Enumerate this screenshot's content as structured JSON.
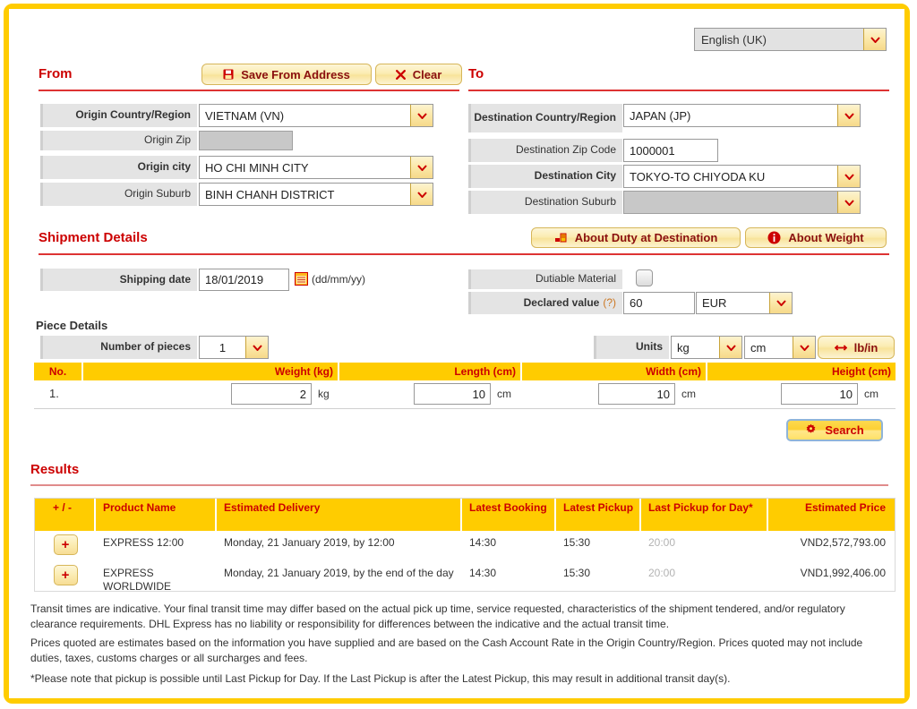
{
  "language": {
    "selected": "English (UK)"
  },
  "from": {
    "heading": "From",
    "save_button": "Save From Address",
    "clear_button": "Clear",
    "fields": [
      {
        "label": "Origin Country/Region",
        "value": "VIETNAM (VN)"
      },
      {
        "label": "Origin Zip",
        "value": ""
      },
      {
        "label": "Origin city",
        "value": "HO CHI MINH CITY"
      },
      {
        "label": "Origin Suburb",
        "value": "BINH CHANH DISTRICT"
      }
    ]
  },
  "to": {
    "heading": "To",
    "fields": [
      {
        "label": "Destination Country/Region",
        "value": "JAPAN (JP)"
      },
      {
        "label": "Destination Zip Code",
        "value": "1000001"
      },
      {
        "label": "Destination City",
        "value": "TOKYO-TO CHIYODA KU"
      },
      {
        "label": "Destination Suburb",
        "value": ""
      }
    ]
  },
  "shipment_details": {
    "heading": "Shipment Details",
    "about_duty_button": "About Duty at Destination",
    "about_weight_button": "About Weight",
    "shipping_date_label": "Shipping date",
    "shipping_date_value": "18/01/2019",
    "shipping_date_format": "(dd/mm/yy)",
    "dutiable_label": "Dutiable Material",
    "declared_value_label": "Declared value",
    "declared_value_help": "(?)",
    "declared_value": "60",
    "currency": "EUR"
  },
  "piece_details": {
    "heading": "Piece Details",
    "number_of_pieces_label": "Number of pieces",
    "number_of_pieces": "1",
    "units_label": "Units",
    "weight_unit": "kg",
    "dim_unit": "cm",
    "toggle_units_button": "lb/in",
    "columns": [
      "No.",
      "Weight (kg)",
      "Length (cm)",
      "Width (cm)",
      "Height (cm)"
    ],
    "rows": [
      {
        "no": "1.",
        "weight": "2",
        "weight_unit": "kg",
        "length": "10",
        "length_unit": "cm",
        "width": "10",
        "width_unit": "cm",
        "height": "10",
        "height_unit": "cm"
      }
    ],
    "search_button": "Search"
  },
  "results": {
    "heading": "Results",
    "columns": [
      "+ / -",
      "Product Name",
      "Estimated Delivery",
      "Latest Booking",
      "Latest Pickup",
      "Last Pickup for Day*",
      "Estimated Price"
    ],
    "rows": [
      {
        "expand": "+",
        "product": "EXPRESS 12:00",
        "delivery": "Monday, 21 January 2019, by 12:00",
        "latest_booking": "14:30",
        "latest_pickup": "15:30",
        "last_pickup_for_day": "20:00",
        "price": "VND2,572,793.00"
      },
      {
        "expand": "+",
        "product": "EXPRESS WORLDWIDE",
        "delivery": "Monday, 21 January 2019, by the end of the day",
        "latest_booking": "14:30",
        "latest_pickup": "15:30",
        "last_pickup_for_day": "20:00",
        "price": "VND1,992,406.00"
      }
    ]
  },
  "notes": [
    "Transit times are indicative. Your final transit time may differ based on the actual pick up time, service requested, characteristics of the shipment tendered, and/or regulatory clearance requirements. DHL Express has no liability or responsibility for differences between the indicative and the actual transit time.",
    "Prices quoted are estimates based on the information you have supplied and are based on the Cash Account Rate in the Origin Country/Region. Prices quoted may not include duties, taxes, customs charges or all surcharges and fees.",
    "*Please note that pickup is possible until Last Pickup for Day. If the Last Pickup is after the Latest Pickup, this may result in additional transit day(s)."
  ],
  "colors": {
    "dhl_yellow": "#FFCC00",
    "dhl_red": "#CC0000",
    "label_grey": "#E4E4E4",
    "muted_grey": "#B3B3B3"
  }
}
